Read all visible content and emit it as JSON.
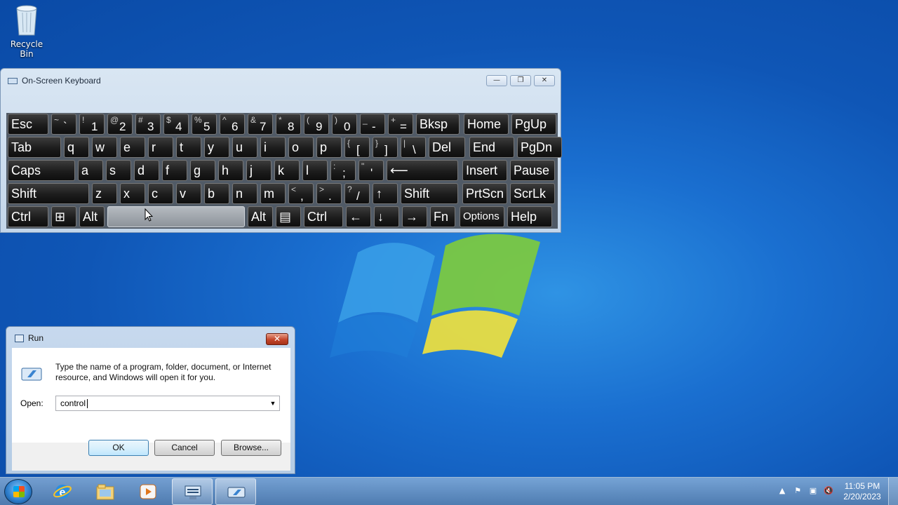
{
  "desktop": {
    "recycle_bin_label": "Recycle Bin"
  },
  "osk": {
    "title": "On-Screen Keyboard",
    "window_buttons": [
      "minimize",
      "restore",
      "close"
    ],
    "rows": [
      [
        {
          "k": "esc",
          "main": "Esc"
        },
        {
          "k": "backtick",
          "sh": "~",
          "main": "`"
        },
        {
          "k": "1",
          "sh": "!",
          "main": "1"
        },
        {
          "k": "2",
          "sh": "@",
          "main": "2"
        },
        {
          "k": "3",
          "sh": "#",
          "main": "3"
        },
        {
          "k": "4",
          "sh": "$",
          "main": "4"
        },
        {
          "k": "5",
          "sh": "%",
          "main": "5"
        },
        {
          "k": "6",
          "sh": "^",
          "main": "6"
        },
        {
          "k": "7",
          "sh": "&",
          "main": "7"
        },
        {
          "k": "8",
          "sh": "*",
          "main": "8"
        },
        {
          "k": "9",
          "sh": "(",
          "main": "9"
        },
        {
          "k": "0",
          "sh": ")",
          "main": "0"
        },
        {
          "k": "minus",
          "sh": "_",
          "main": "-"
        },
        {
          "k": "equal",
          "sh": "+",
          "main": "="
        },
        {
          "k": "bksp",
          "main": "Bksp"
        },
        {
          "k": "home",
          "main": "Home"
        },
        {
          "k": "pgup",
          "main": "PgUp"
        }
      ],
      [
        {
          "k": "tab",
          "main": "Tab"
        },
        {
          "k": "q",
          "main": "q"
        },
        {
          "k": "w",
          "main": "w"
        },
        {
          "k": "e",
          "main": "e"
        },
        {
          "k": "r",
          "main": "r"
        },
        {
          "k": "t",
          "main": "t"
        },
        {
          "k": "y",
          "main": "y"
        },
        {
          "k": "u",
          "main": "u"
        },
        {
          "k": "i",
          "main": "i"
        },
        {
          "k": "o",
          "main": "o"
        },
        {
          "k": "p",
          "main": "p"
        },
        {
          "k": "lbracket",
          "sh": "{",
          "main": "["
        },
        {
          "k": "rbracket",
          "sh": "}",
          "main": "]"
        },
        {
          "k": "backslash",
          "sh": "|",
          "main": "\\"
        },
        {
          "k": "del",
          "main": "Del"
        },
        {
          "k": "end",
          "main": "End"
        },
        {
          "k": "pgdn",
          "main": "PgDn"
        }
      ],
      [
        {
          "k": "caps",
          "main": "Caps"
        },
        {
          "k": "a",
          "main": "a"
        },
        {
          "k": "s",
          "main": "s"
        },
        {
          "k": "d",
          "main": "d"
        },
        {
          "k": "f",
          "main": "f"
        },
        {
          "k": "g",
          "main": "g"
        },
        {
          "k": "h",
          "main": "h"
        },
        {
          "k": "j",
          "main": "j"
        },
        {
          "k": "k",
          "main": "k"
        },
        {
          "k": "l",
          "main": "l"
        },
        {
          "k": "semicolon",
          "sh": ":",
          "main": ";"
        },
        {
          "k": "quote",
          "sh": "\"",
          "main": "'"
        },
        {
          "k": "enter",
          "main": "⟵"
        },
        {
          "k": "insert",
          "main": "Insert"
        },
        {
          "k": "pause",
          "main": "Pause"
        }
      ],
      [
        {
          "k": "lshift",
          "main": "Shift"
        },
        {
          "k": "z",
          "main": "z"
        },
        {
          "k": "x",
          "main": "x"
        },
        {
          "k": "c",
          "main": "c"
        },
        {
          "k": "v",
          "main": "v"
        },
        {
          "k": "b",
          "main": "b"
        },
        {
          "k": "n",
          "main": "n"
        },
        {
          "k": "m",
          "main": "m"
        },
        {
          "k": "comma",
          "sh": "<",
          "main": ","
        },
        {
          "k": "period",
          "sh": ">",
          "main": "."
        },
        {
          "k": "slash",
          "sh": "?",
          "main": "/"
        },
        {
          "k": "up",
          "main": "↑"
        },
        {
          "k": "rshift",
          "main": "Shift"
        },
        {
          "k": "prtscn",
          "main": "PrtScn"
        },
        {
          "k": "scrlk",
          "main": "ScrLk"
        }
      ],
      [
        {
          "k": "lctrl",
          "main": "Ctrl"
        },
        {
          "k": "win",
          "main": "⊞"
        },
        {
          "k": "lalt",
          "main": "Alt"
        },
        {
          "k": "space",
          "main": ""
        },
        {
          "k": "ralt",
          "main": "Alt"
        },
        {
          "k": "menu",
          "main": "▤"
        },
        {
          "k": "rctrl",
          "main": "Ctrl"
        },
        {
          "k": "left",
          "main": "←"
        },
        {
          "k": "down",
          "main": "↓"
        },
        {
          "k": "right",
          "main": "→"
        },
        {
          "k": "fn",
          "main": "Fn"
        },
        {
          "k": "options",
          "main": "Options"
        },
        {
          "k": "help",
          "main": "Help"
        }
      ]
    ]
  },
  "run": {
    "title": "Run",
    "description": "Type the name of a program, folder, document, or Internet resource, and Windows will open it for you.",
    "open_label": "Open:",
    "open_value": "control",
    "ok_label": "OK",
    "cancel_label": "Cancel",
    "browse_label": "Browse..."
  },
  "taskbar": {
    "apps": [
      "internet-explorer-icon",
      "windows-explorer-icon",
      "media-player-icon",
      "on-screen-keyboard-icon",
      "run-dialog-icon"
    ],
    "clock_time": "11:05 PM",
    "clock_date": "2/20/2023"
  }
}
